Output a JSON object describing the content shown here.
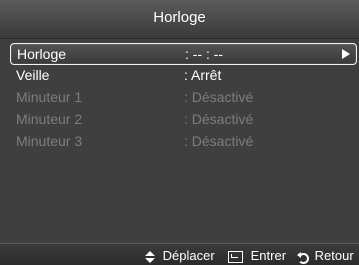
{
  "title": "Horloge",
  "menu": {
    "items": [
      {
        "label": "Horloge",
        "value": ": -- : --",
        "state": "selected"
      },
      {
        "label": "Veille",
        "value": ": Arrêt",
        "state": "normal"
      },
      {
        "label": "Minuteur 1",
        "value": ": Désactivé",
        "state": "disabled"
      },
      {
        "label": "Minuteur 2",
        "value": ": Désactivé",
        "state": "disabled"
      },
      {
        "label": "Minuteur 3",
        "value": ": Désactivé",
        "state": "disabled"
      }
    ]
  },
  "footer": {
    "move_label": "Déplacer",
    "enter_label": "Entrer",
    "return_label": "Retour"
  },
  "icons": {
    "selected_arrow": "play-arrow-icon",
    "move": "up-down-icon",
    "enter": "enter-icon",
    "return": "return-icon"
  },
  "colors": {
    "panel_background": "#3f3f3f",
    "text": "#ffffff",
    "disabled_text": "#7d7d7d"
  }
}
